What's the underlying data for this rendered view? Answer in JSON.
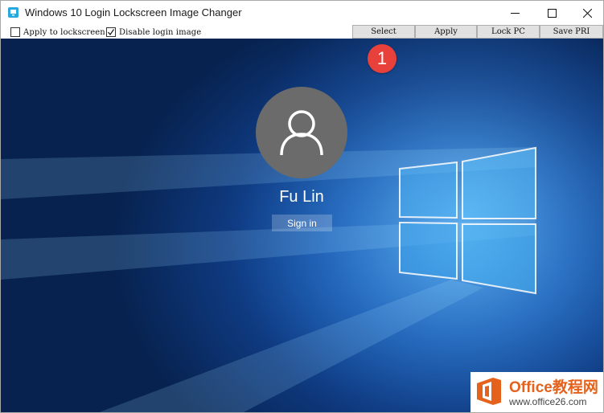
{
  "window": {
    "title": "Windows 10 Login Lockscreen Image Changer"
  },
  "toolbar": {
    "apply_lockscreen_label": "Apply to lockscreen",
    "apply_lockscreen_checked": false,
    "disable_login_label": "Disable login image",
    "disable_login_checked": true,
    "select_label": "Select",
    "apply_label": "Apply",
    "lock_pc_label": "Lock PC",
    "save_pri_label": "Save PRI"
  },
  "preview": {
    "step_marker": "1",
    "user_name": "Fu Lin",
    "sign_in_label": "Sign in"
  },
  "watermark": {
    "brand": "Office教程网",
    "url": "www.office26.com"
  },
  "colors": {
    "marker": "#e8413c",
    "brand": "#e4621b",
    "background_blue": "#1c5fb7"
  }
}
